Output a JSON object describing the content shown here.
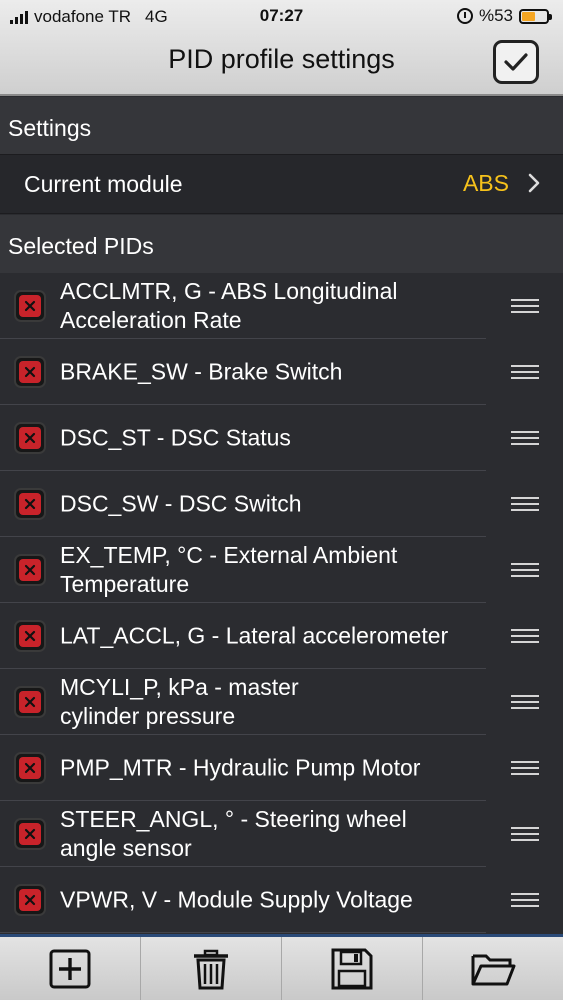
{
  "status_bar": {
    "carrier": "vodafone TR",
    "network": "4G",
    "time": "07:27",
    "battery": "%53",
    "battery_level": 0.53
  },
  "nav": {
    "title": "PID profile settings",
    "confirm_icon": "checkmark-icon"
  },
  "settings": {
    "header": "Settings",
    "current_module_label": "Current module",
    "current_module_value": "ABS"
  },
  "pids": {
    "header": "Selected PIDs",
    "items": [
      {
        "label": "ACCLMTR, G - ABS Longitudinal\nAcceleration Rate"
      },
      {
        "label": "BRAKE_SW - Brake Switch"
      },
      {
        "label": "DSC_ST - DSC Status"
      },
      {
        "label": "DSC_SW - DSC Switch"
      },
      {
        "label": "EX_TEMP, °C - External Ambient\nTemperature"
      },
      {
        "label": "LAT_ACCL, G - Lateral accelerometer"
      },
      {
        "label": "MCYLI_P, kPa - master\ncylinder pressure"
      },
      {
        "label": "PMP_MTR - Hydraulic Pump Motor"
      },
      {
        "label": "STEER_ANGL, ° - Steering wheel\nangle sensor"
      },
      {
        "label": "VPWR, V - Module Supply Voltage"
      }
    ]
  },
  "toolbar": {
    "items": [
      "add-icon",
      "trash-icon",
      "save-icon",
      "folder-icon"
    ]
  },
  "colors": {
    "accent": "#f6c21b",
    "remove": "#c8232a",
    "background": "#2b2c30"
  }
}
